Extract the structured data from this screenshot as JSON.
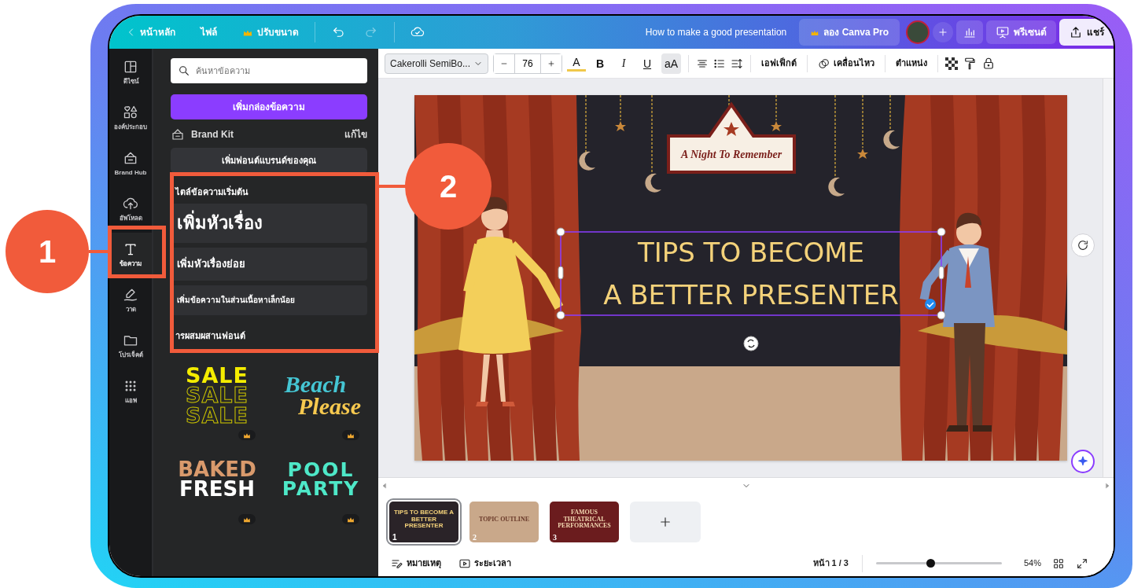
{
  "topbar": {
    "back_label": "หน้าหลัก",
    "file_menu": "ไฟล์",
    "resize": "ปรับขนาด",
    "title": "How to make a good presentation",
    "pro_button": "ลอง Canva Pro",
    "present_button": "พรีเซนต์",
    "share_button": "แชร์"
  },
  "sidebar": {
    "items": [
      {
        "label": "ดีไซน์",
        "selected": false
      },
      {
        "label": "องค์ประกอบ",
        "selected": false
      },
      {
        "label": "Brand Hub",
        "selected": false
      },
      {
        "label": "อัพโหลด",
        "selected": false
      },
      {
        "label": "ข้อความ",
        "selected": true
      },
      {
        "label": "วาด",
        "selected": false
      },
      {
        "label": "โปรเจ็คต์",
        "selected": false
      },
      {
        "label": "แอพ",
        "selected": false
      }
    ]
  },
  "panel": {
    "search": {
      "placeholder": "ค้นหาข้อความ"
    },
    "add_textbox": "เพิ่มกล่องข้อความ",
    "brand_kit": "Brand Kit",
    "edit": "แก้ไข",
    "add_brand_font": "เพิ่มฟอนต์แบรนด์ของคุณ",
    "default_styles_heading": "ไตล์ข้อความเริ่มต้น",
    "styles": [
      {
        "kind": "heading",
        "text": "เพิ่มหัวเรื่อง"
      },
      {
        "kind": "subheading",
        "text": "เพิ่มหัวเรื่องย่อย"
      },
      {
        "kind": "body",
        "text": "เพิ่มข้อความในส่วนเนื้อหาเล็กน้อย"
      }
    ],
    "combos_heading": "ารผสมผสานฟอนต์",
    "combos": [
      {
        "kind": "sale",
        "lines": [
          "SALE",
          "SALE",
          "SALE"
        ],
        "premium": true
      },
      {
        "kind": "beach",
        "lines": [
          "Beach",
          "Please"
        ],
        "premium": true
      },
      {
        "kind": "baked",
        "lines": [
          "BAKED",
          "FRESH"
        ],
        "premium": true
      },
      {
        "kind": "pool",
        "lines": [
          "POOL",
          "PARTY"
        ],
        "premium": true
      }
    ]
  },
  "toolbar": {
    "font": "Cakerolli SemiBo...",
    "size": "76",
    "format_buttons": [
      {
        "kind": "color",
        "label": "A",
        "selected": false
      },
      {
        "kind": "bold",
        "label": "B",
        "selected": false
      },
      {
        "kind": "italic",
        "label": "I",
        "selected": false
      },
      {
        "kind": "underline",
        "label": "U",
        "selected": false
      },
      {
        "kind": "case",
        "label": "aA",
        "selected": true
      }
    ],
    "effects": "เอฟเฟ็กต์",
    "animate": "เคลื่อนไหว",
    "position": "ตำแหน่ง"
  },
  "slide": {
    "sign": "A Night To Remember",
    "title_lines": [
      "TIPS TO BECOME",
      "A BETTER PRESENTER"
    ]
  },
  "pages": [
    {
      "number": "1",
      "kind": "dark",
      "title": "TIPS TO BECOME A BETTER PRESENTER",
      "selected": true
    },
    {
      "number": "2",
      "kind": "beige",
      "title": "TOPIC OUTLINE",
      "selected": false
    },
    {
      "number": "3",
      "kind": "maroon",
      "title": "FAMOUS THEATRICAL PERFORMANCES",
      "selected": false
    }
  ],
  "footer": {
    "notes": "หมายเหตุ",
    "timer": "ระยะเวลา",
    "page_indicator": "หน้า 1 / 3",
    "zoom": {
      "level": 0.43,
      "reading": "54%"
    }
  },
  "callouts": [
    {
      "number": "1"
    },
    {
      "number": "2"
    }
  ]
}
